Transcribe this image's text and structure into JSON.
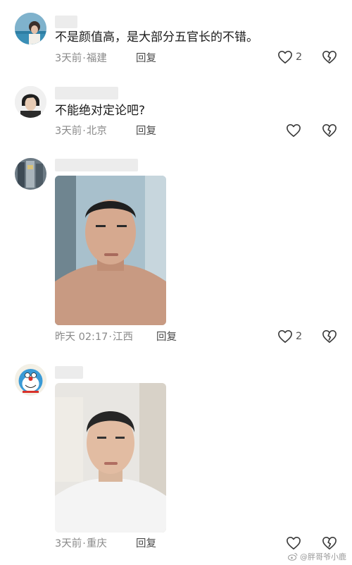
{
  "comments": [
    {
      "text": "不是颜值高，是大部分五官长的不错。",
      "time": "3天前",
      "location": "福建",
      "reply_label": "回复",
      "likes": "2"
    },
    {
      "text": "不能绝对定论吧?",
      "time": "3天前",
      "location": "北京",
      "reply_label": "回复",
      "likes": ""
    },
    {
      "text": "",
      "time": "昨天 02:17",
      "location": "江西",
      "reply_label": "回复",
      "likes": "2"
    },
    {
      "text": "",
      "time": "3天前",
      "location": "重庆",
      "reply_label": "回复",
      "likes": ""
    }
  ],
  "meta_separator": "·",
  "watermark": "@胖哥爷小鹿",
  "icons": {
    "like": "heart-outline-icon",
    "dislike": "broken-heart-icon",
    "weibo": "weibo-icon"
  },
  "colors": {
    "text": "#1b1b1b",
    "meta": "#8a8a8a",
    "icon": "#3a3a3a"
  }
}
